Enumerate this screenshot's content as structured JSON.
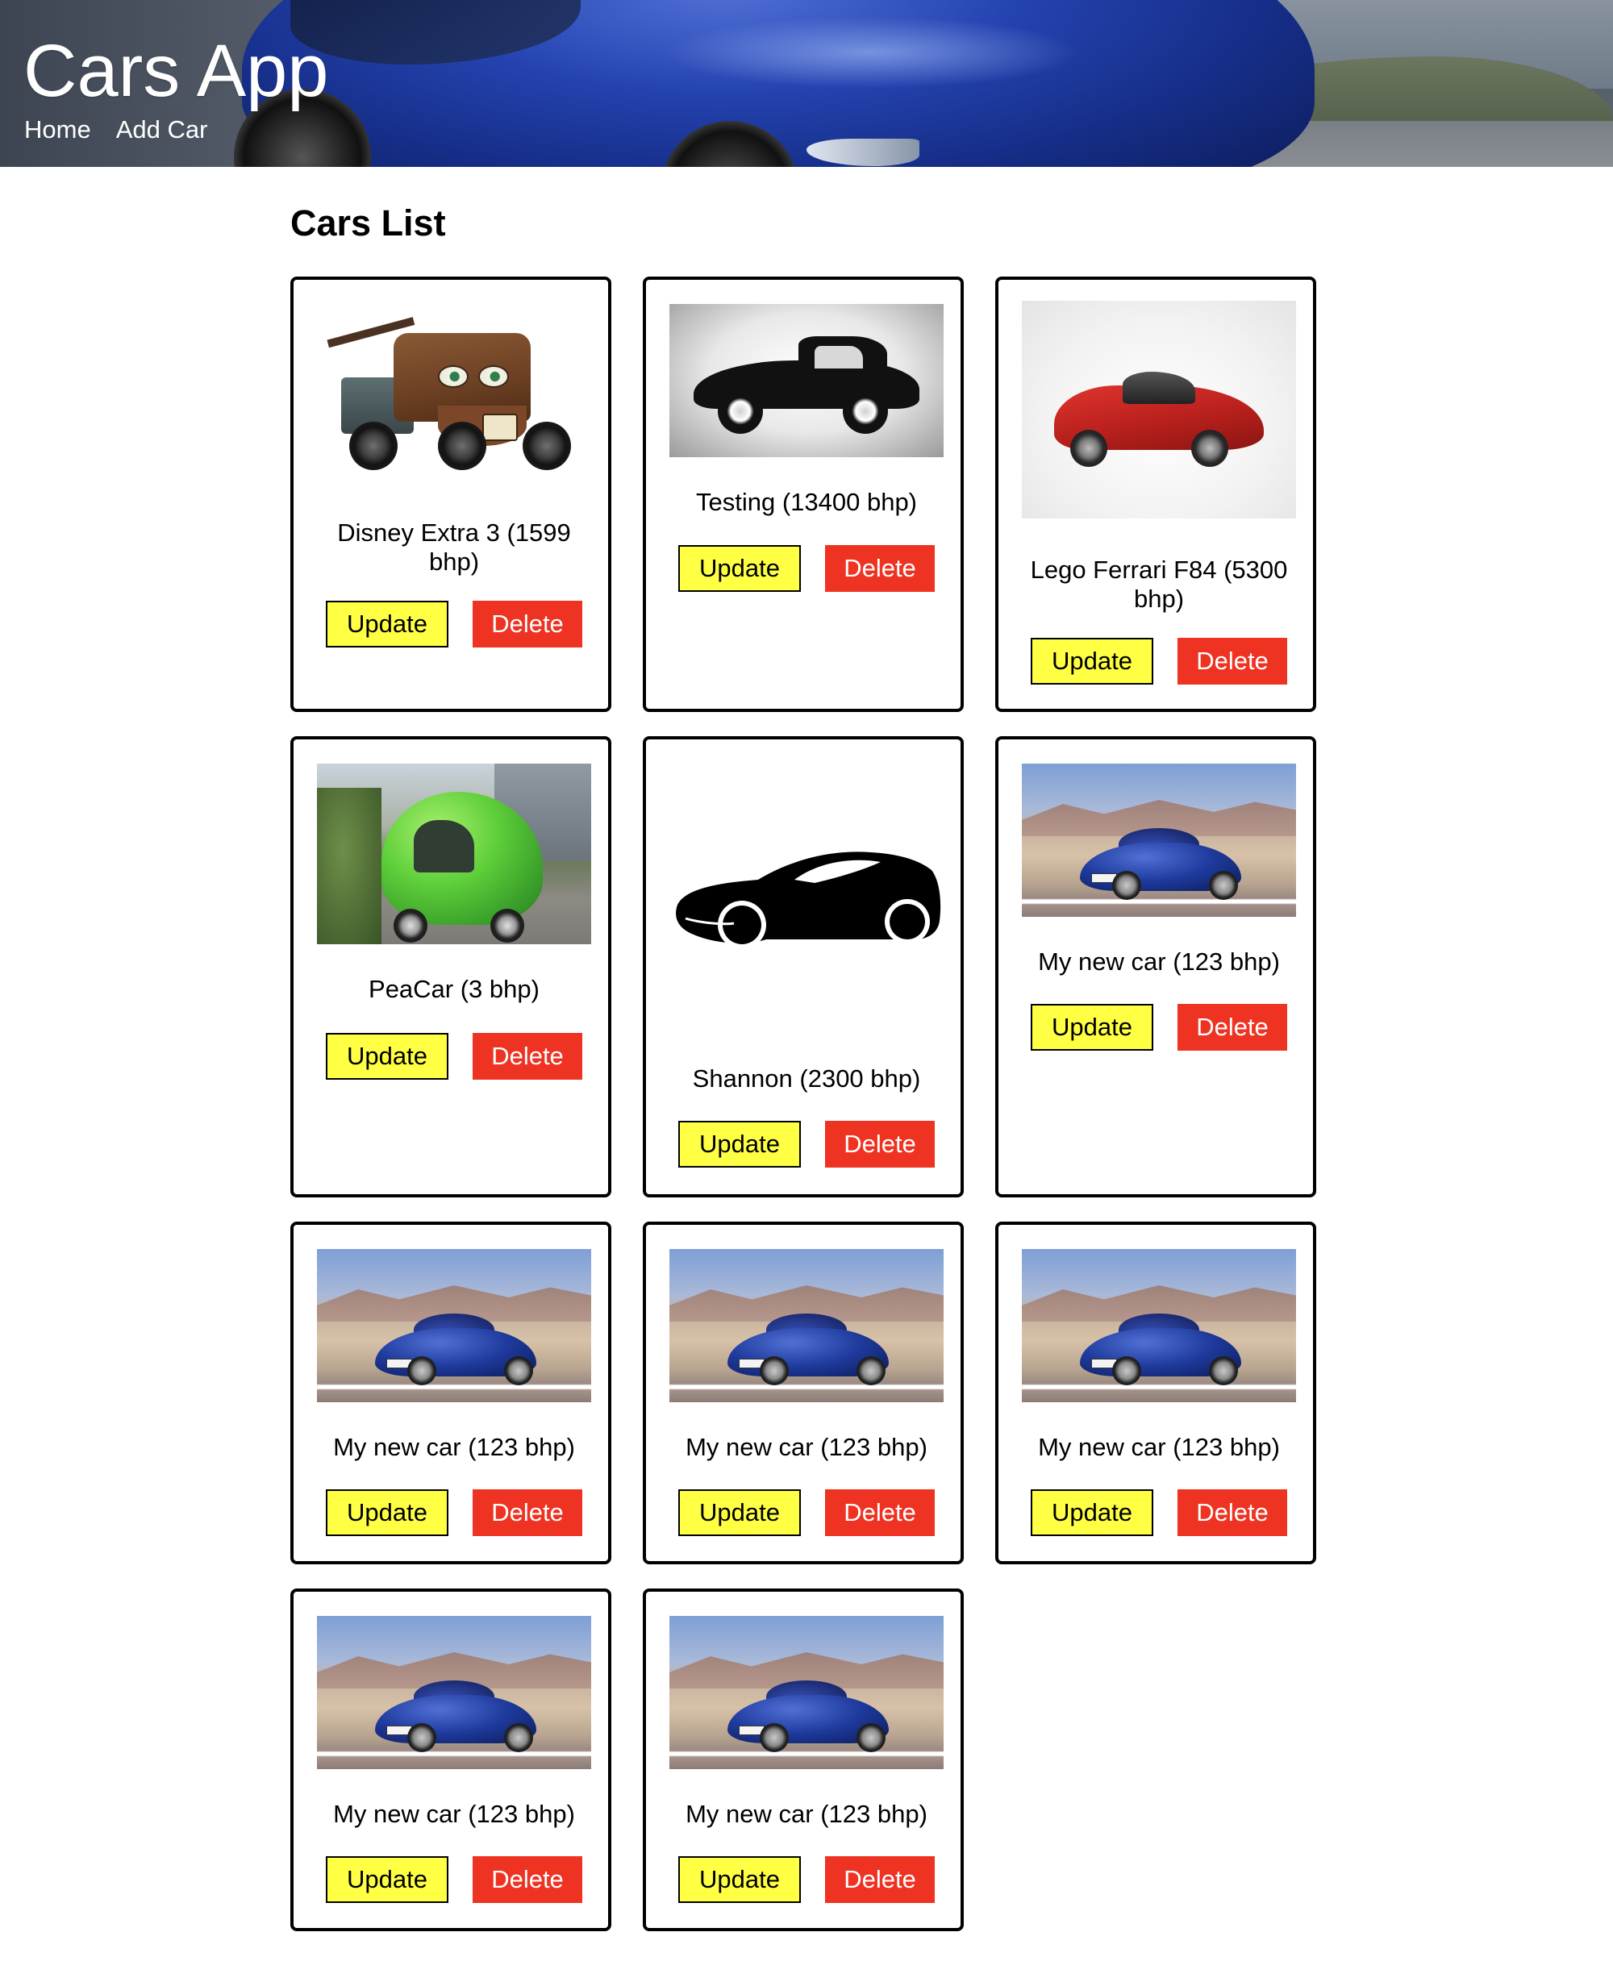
{
  "app": {
    "title": "Cars App"
  },
  "nav": {
    "items": [
      {
        "label": "Home"
      },
      {
        "label": "Add Car"
      }
    ]
  },
  "main": {
    "heading": "Cars List"
  },
  "buttons": {
    "update_label": "Update",
    "delete_label": "Delete"
  },
  "colors": {
    "update_button": "#ffff44",
    "delete_button": "#ee3322",
    "header_text": "#ffffff"
  },
  "cars": [
    {
      "label": "Disney Extra 3 (1599 bhp)",
      "image": "tow-truck-cartoon"
    },
    {
      "label": "Testing (13400 bhp)",
      "image": "classic-black-car"
    },
    {
      "label": "Lego Ferrari F84 (5300 bhp)",
      "image": "red-lego-sports-car"
    },
    {
      "label": "PeaCar (3 bhp)",
      "image": "green-bubble-car"
    },
    {
      "label": "Shannon (2300 bhp)",
      "image": "black-car-silhouette"
    },
    {
      "label": "My new car (123 bhp)",
      "image": "blue-bugatti"
    },
    {
      "label": "My new car (123 bhp)",
      "image": "blue-bugatti"
    },
    {
      "label": "My new car (123 bhp)",
      "image": "blue-bugatti"
    },
    {
      "label": "My new car (123 bhp)",
      "image": "blue-bugatti"
    },
    {
      "label": "My new car (123 bhp)",
      "image": "blue-bugatti"
    },
    {
      "label": "My new car (123 bhp)",
      "image": "blue-bugatti"
    }
  ]
}
